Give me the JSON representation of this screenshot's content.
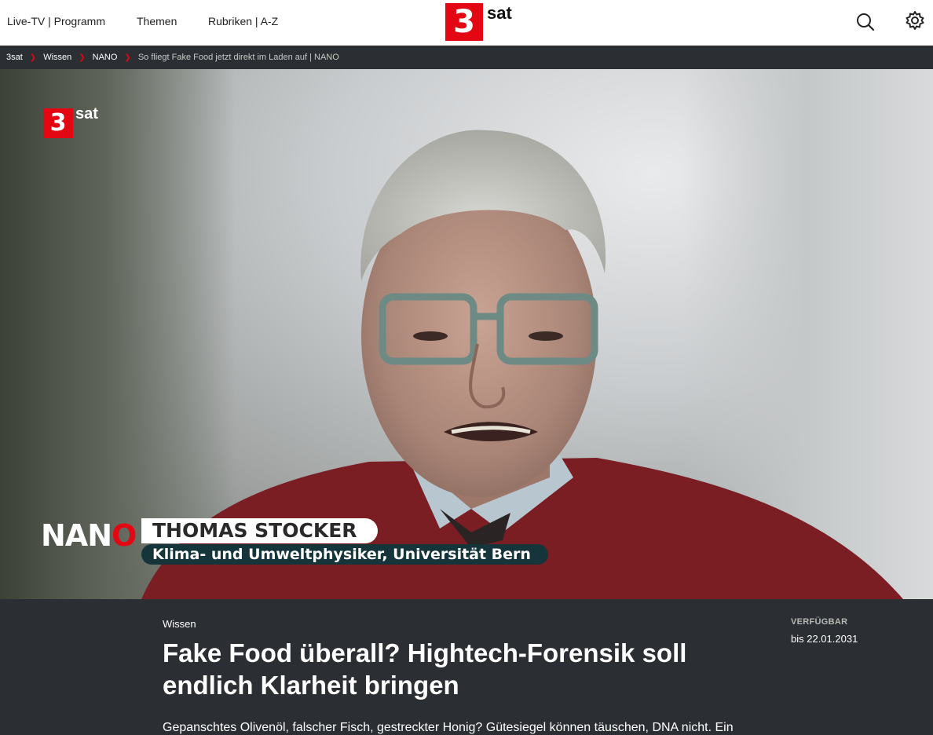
{
  "nav": {
    "live_tv": "Live-TV | Programm",
    "themen": "Themen",
    "rubriken": "Rubriken | A-Z",
    "logo_number": "3",
    "logo_text": "sat",
    "search_icon": "search-icon",
    "settings_icon": "gear-icon"
  },
  "breadcrumb": {
    "items": [
      "3sat",
      "Wissen",
      "NANO",
      "So fliegt Fake Food jetzt direkt im Laden auf | NANO"
    ]
  },
  "video": {
    "logo_number": "3",
    "logo_text": "sat",
    "show_logo": "NANO",
    "person_name": "THOMAS STOCKER",
    "person_role": "Klima- und Umweltphysiker, Universität Bern"
  },
  "article": {
    "category": "Wissen",
    "headline": "Fake Food überall? Hightech-Forensik soll endlich Klarheit bringen",
    "availability_label": "VERFÜGBAR",
    "availability_date": "bis 22.01.2031",
    "teaser": "Gepanschtes Olivenöl, falscher Fisch, gestreckter Honig? Gütesiegel können täuschen, DNA nicht. Ein"
  },
  "colors": {
    "brand_red": "#e30613",
    "dark_bg": "#2b2e33",
    "role_bar": "#15353a"
  }
}
